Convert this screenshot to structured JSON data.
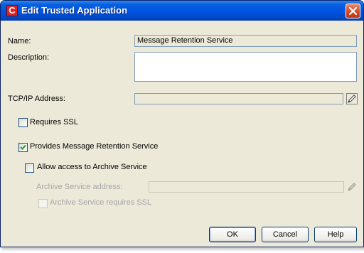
{
  "window": {
    "title": "Edit Trusted Application",
    "app_icon_glyph": "C",
    "icon": "app-logo-icon"
  },
  "form": {
    "name_label": "Name:",
    "name_value": "Message Retention Service",
    "description_label": "Description:",
    "description_value": "",
    "tcpip_label": "TCP/IP Address:",
    "tcpip_value": "",
    "requires_ssl_label": "Requires SSL",
    "requires_ssl_checked": false,
    "provides_retention_label": "Provides Message Retention Service",
    "provides_retention_checked": true,
    "allow_archive_label": "Allow access to Archive Service",
    "allow_archive_checked": false,
    "archive_address_label": "Archive Service address:",
    "archive_address_value": "",
    "archive_ssl_label": "Archive Service requires SSL",
    "archive_ssl_checked": false
  },
  "buttons": {
    "ok": "OK",
    "cancel": "Cancel",
    "help": "Help"
  },
  "colors": {
    "titlebar": "#0054e3",
    "dialog_bg": "#ece9d8",
    "close_button": "#d2441e",
    "disabled_text": "#a7a6aa"
  }
}
